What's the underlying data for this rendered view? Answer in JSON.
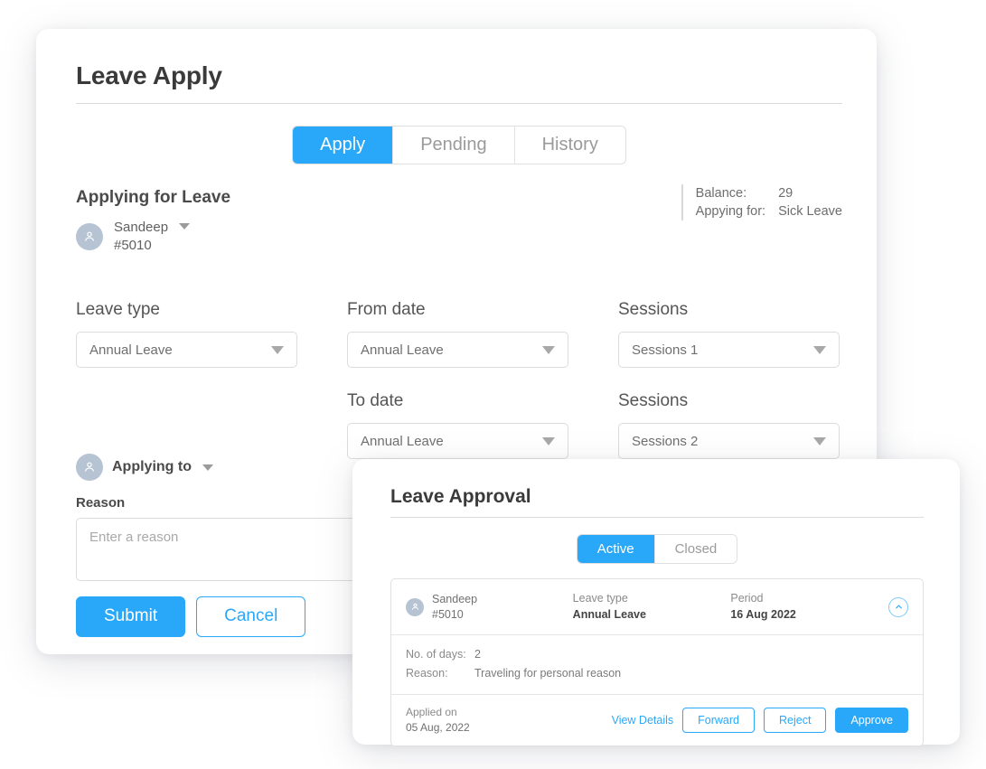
{
  "apply_panel": {
    "title": "Leave Apply",
    "tabs": [
      {
        "label": "Apply",
        "active": true
      },
      {
        "label": "Pending",
        "active": false
      },
      {
        "label": "History",
        "active": false
      }
    ],
    "section_heading": "Applying for Leave",
    "applicant": {
      "name": "Sandeep",
      "id": "#5010"
    },
    "balance": {
      "balance_label": "Balance:",
      "balance_value": "29",
      "applying_for_label": "Appying for:",
      "applying_for_value": "Sick Leave"
    },
    "fields": {
      "leave_type": {
        "label": "Leave type",
        "value": "Annual Leave"
      },
      "from_date": {
        "label": "From date",
        "value": "Annual Leave"
      },
      "sessions_1": {
        "label": "Sessions",
        "value": "Sessions 1"
      },
      "to_date": {
        "label": "To date",
        "value": "Annual Leave"
      },
      "sessions_2": {
        "label": "Sessions",
        "value": "Sessions 2"
      }
    },
    "applying_to_label": "Applying to",
    "reason": {
      "label": "Reason",
      "placeholder": "Enter a reason",
      "value": ""
    },
    "submit_label": "Submit",
    "cancel_label": "Cancel"
  },
  "approval_panel": {
    "title": "Leave Approval",
    "tabs": [
      {
        "label": "Active",
        "active": true
      },
      {
        "label": "Closed",
        "active": false
      }
    ],
    "request": {
      "applicant": {
        "name": "Sandeep",
        "id": "#5010"
      },
      "leave_type_label": "Leave type",
      "leave_type_value": "Annual Leave",
      "period_label": "Period",
      "period_value": "16 Aug 2022",
      "days_label": "No. of days:",
      "days_value": "2",
      "reason_label": "Reason:",
      "reason_value": "Traveling for personal reason",
      "applied_on_label": "Applied on",
      "applied_on_value": "05 Aug, 2022",
      "view_details_label": "View Details",
      "forward_label": "Forward",
      "reject_label": "Reject",
      "approve_label": "Approve"
    }
  },
  "colors": {
    "accent": "#29a8fa",
    "avatar": "#b6c3d2",
    "text_dark": "#3a3a3a",
    "text_muted": "#8a8a8a",
    "border": "#dcdcdc"
  }
}
